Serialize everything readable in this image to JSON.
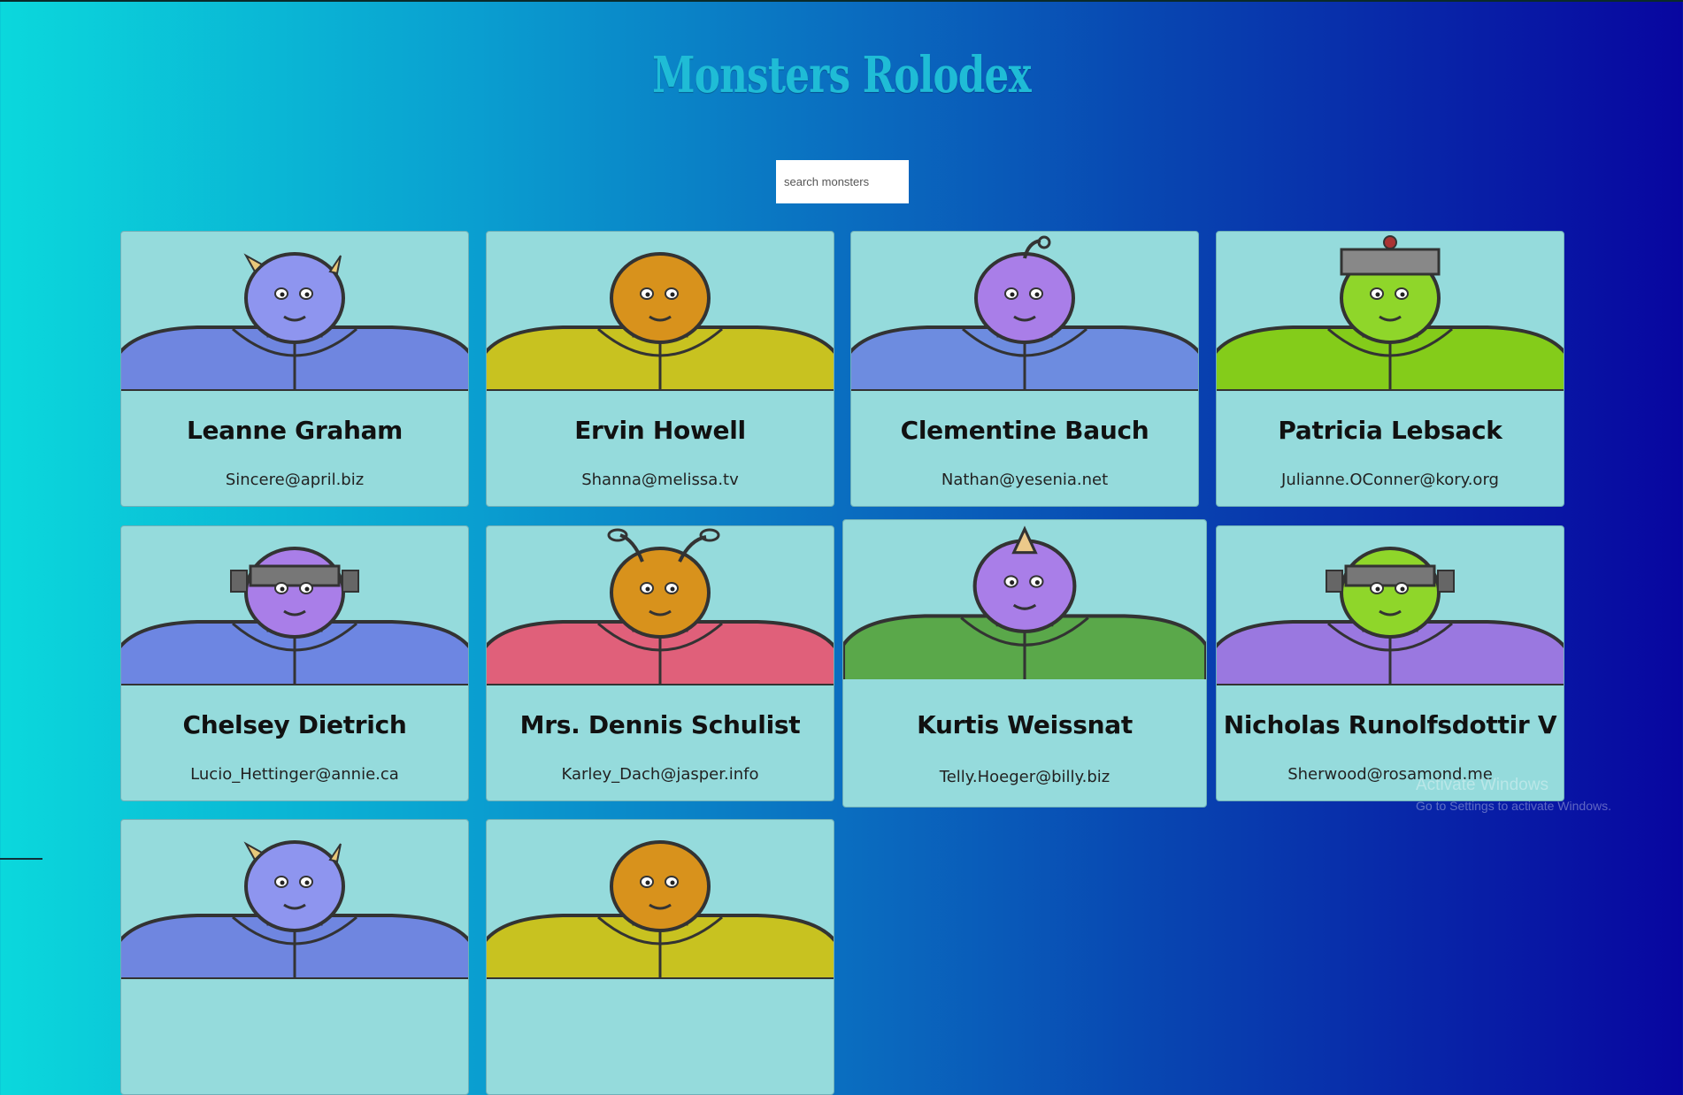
{
  "app": {
    "title": "Monsters Rolodex"
  },
  "search": {
    "placeholder": "search monsters"
  },
  "monsters": [
    {
      "name": "Leanne Graham",
      "email": "Sincere@april.biz",
      "head": "#8e95ef",
      "body": "#6f86e0",
      "feature": "horns"
    },
    {
      "name": "Ervin Howell",
      "email": "Shanna@melissa.tv",
      "head": "#d8921c",
      "body": "#c8c220",
      "feature": "none"
    },
    {
      "name": "Clementine Bauch",
      "email": "Nathan@yesenia.net",
      "head": "#a97ee8",
      "body": "#6d8ce0",
      "feature": "antenna"
    },
    {
      "name": "Patricia Lebsack",
      "email": "Julianne.OConner@kory.org",
      "head": "#8fd62a",
      "body": "#84cc1a",
      "feature": "helmet"
    },
    {
      "name": "Chelsey Dietrich",
      "email": "Lucio_Hettinger@annie.ca",
      "head": "#a97ee8",
      "body": "#6d86e2",
      "feature": "bolts"
    },
    {
      "name": "Mrs. Dennis Schulist",
      "email": "Karley_Dach@jasper.info",
      "head": "#d8921c",
      "body": "#e0607a",
      "feature": "antennae"
    },
    {
      "name": "Kurtis Weissnat",
      "email": "Telly.Hoeger@billy.biz",
      "head": "#a97ee8",
      "body": "#5aa84a",
      "feature": "horn"
    },
    {
      "name": "Nicholas Runolfsdottir V",
      "email": "Sherwood@rosamond.me",
      "head": "#8fd62a",
      "body": "#9a78e0",
      "feature": "bolts"
    },
    {
      "name": "",
      "email": "",
      "head": "#8e95ef",
      "body": "#6f86e0",
      "feature": "horns"
    },
    {
      "name": "",
      "email": "",
      "head": "#d8921c",
      "body": "#c8c220",
      "feature": "none"
    }
  ],
  "watermark": {
    "line1": "Activate Windows",
    "line2": "Go to Settings to activate Windows."
  }
}
